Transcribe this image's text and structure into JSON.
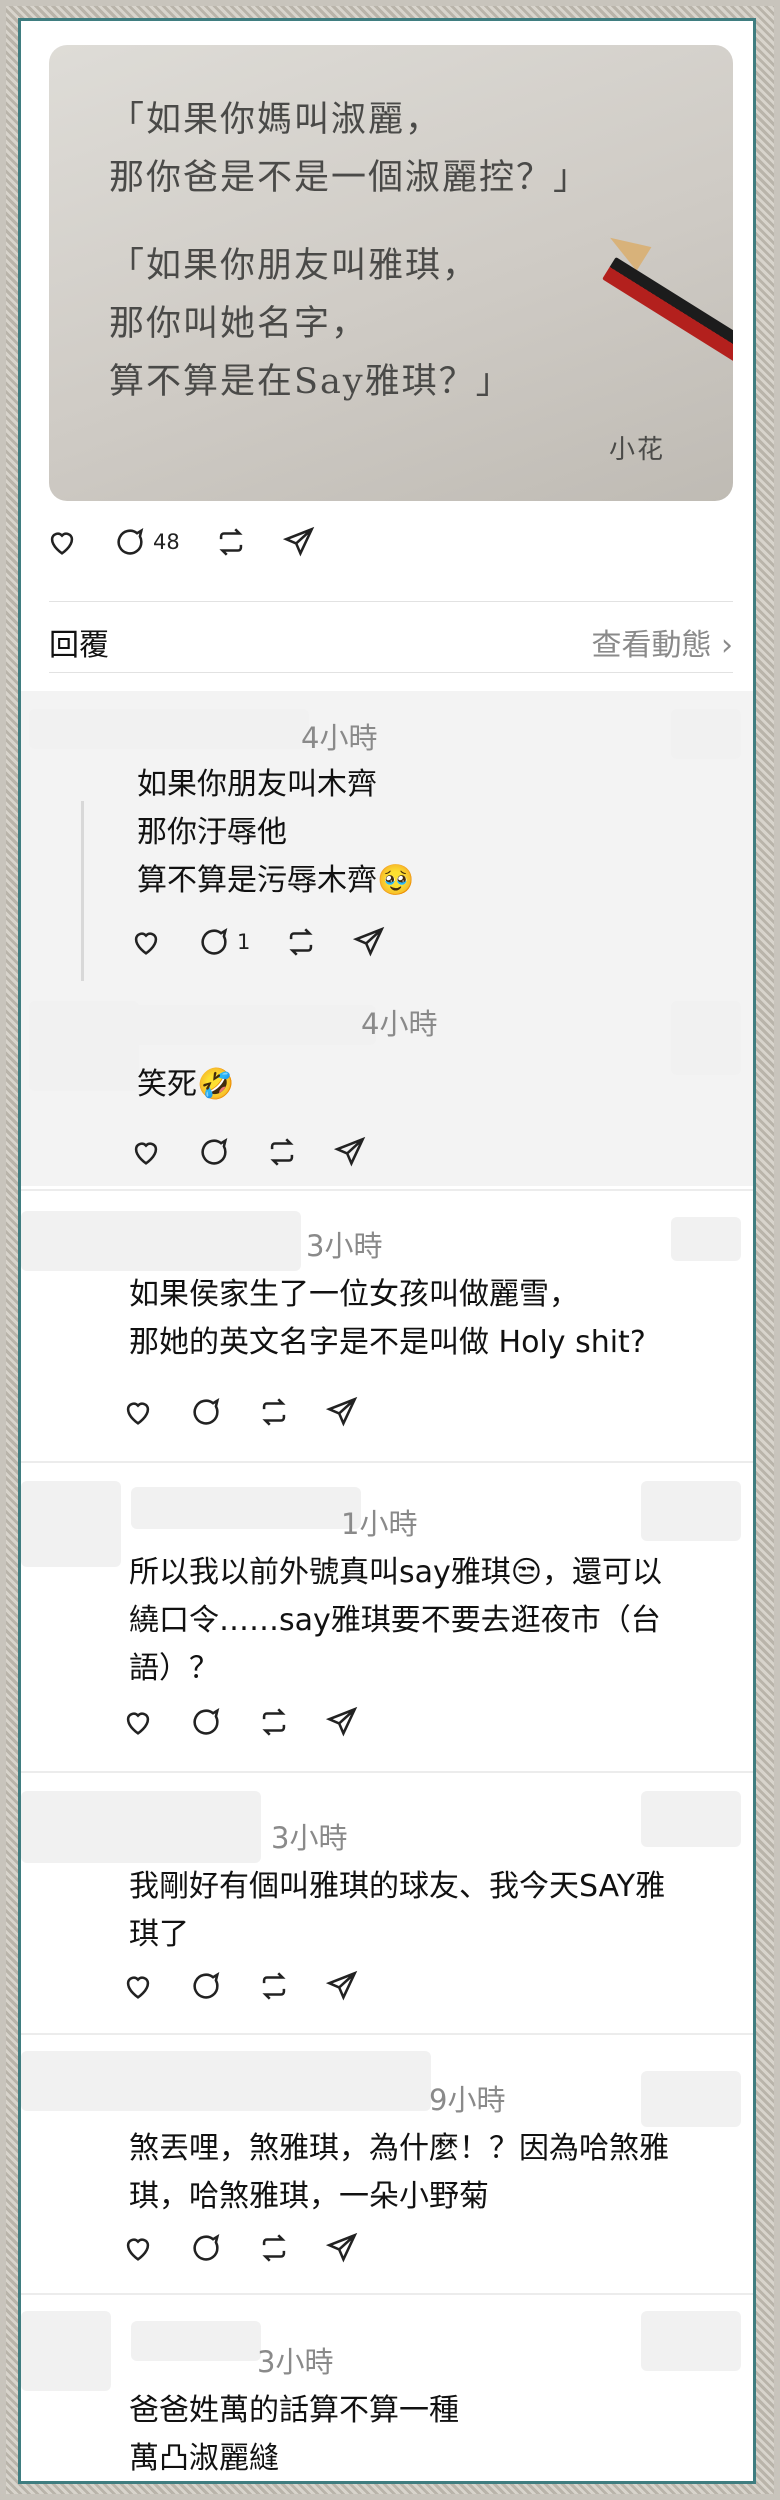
{
  "post": {
    "image_text_lines": [
      "「如果你媽叫淑麗，",
      "那你爸是不是一個淑麗控？」",
      "「如果你朋友叫雅琪，",
      "那你叫她名字，",
      "算不算是在Say雅琪？」"
    ],
    "signature": "小花",
    "comment_count": "48"
  },
  "replies_header": {
    "title": "回覆",
    "link": "查看動態 ›"
  },
  "comments": [
    {
      "time": "4小時",
      "text": "如果你朋友叫木齊\n那你汙辱他\n算不算是污辱木齊🥹",
      "reply_count": "1"
    },
    {
      "time": "4小時",
      "text": "笑死🤣",
      "reply_count": ""
    },
    {
      "time": "3小時",
      "text": "如果侯家生了一位女孩叫做麗雪，\n那她的英文名字是不是叫做 Holy shit?",
      "reply_count": ""
    },
    {
      "time": "1小時",
      "text": "所以我以前外號真叫say雅琪😒，還可以\n繞口令……say雅琪要不要去逛夜市（台\n語）？",
      "reply_count": ""
    },
    {
      "time": "3小時",
      "text": "我剛好有個叫雅琪的球友、我今天SAY雅\n琪了",
      "reply_count": ""
    },
    {
      "time": "9小時",
      "text": "煞丟哩，煞雅琪，為什麼！？因為哈煞雅\n琪，哈煞雅琪，一朵小野菊",
      "reply_count": ""
    },
    {
      "time": "3小時",
      "text": "爸爸姓萬的話算不算一種\n萬凸淑麗縫",
      "reply_count": ""
    }
  ]
}
